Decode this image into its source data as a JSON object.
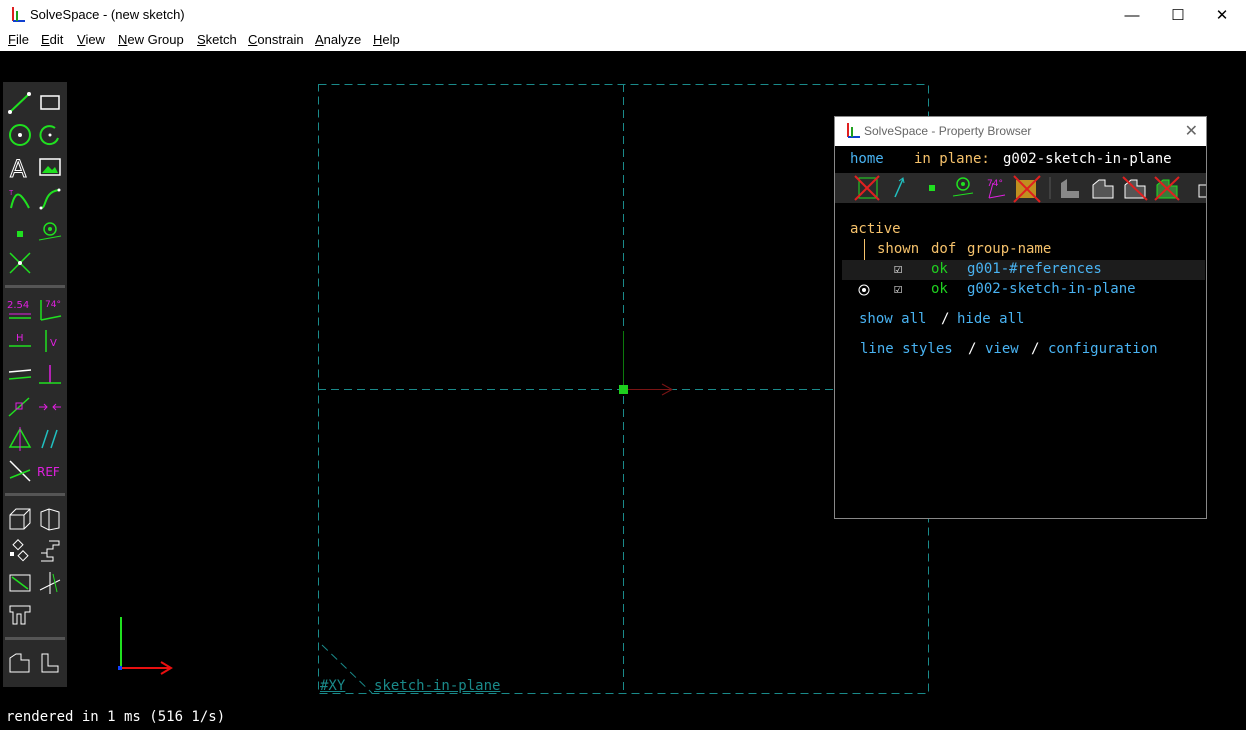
{
  "window": {
    "title": "SolveSpace - (new sketch)",
    "minimize": "—",
    "maximize": "☐",
    "close": "✕"
  },
  "menu": [
    "File",
    "Edit",
    "View",
    "New Group",
    "Sketch",
    "Constrain",
    "Analyze",
    "Help"
  ],
  "canvas": {
    "workplane_label": "#XY",
    "group_label": "sketch-in-plane"
  },
  "property_browser": {
    "title": "SolveSpace - Property Browser",
    "close": "✕",
    "nav_home": "home",
    "nav_context_label": "in plane:",
    "nav_context_value": "g002-sketch-in-plane",
    "section": "active",
    "header": {
      "shown": "shown",
      "dof": "dof",
      "group_name": "group-name"
    },
    "groups": [
      {
        "shown": "☑",
        "dof": "ok",
        "name": "g001-#references",
        "active": false
      },
      {
        "shown": "☑",
        "dof": "ok",
        "name": "g002-sketch-in-plane",
        "active": true
      }
    ],
    "show_all": "show all",
    "slash1": "/",
    "hide_all": "hide all",
    "line_styles": "line styles",
    "slash2": "/",
    "view": "view",
    "slash3": "/",
    "configuration": "configuration"
  },
  "status": "rendered in 1 ms (516 1/s)",
  "colors": {
    "link": "#49b3f2",
    "header_text": "#f6c26b",
    "ok": "#20d020",
    "grid": "#1a8a8a",
    "toolbar_bg": "#2a2a2a"
  }
}
